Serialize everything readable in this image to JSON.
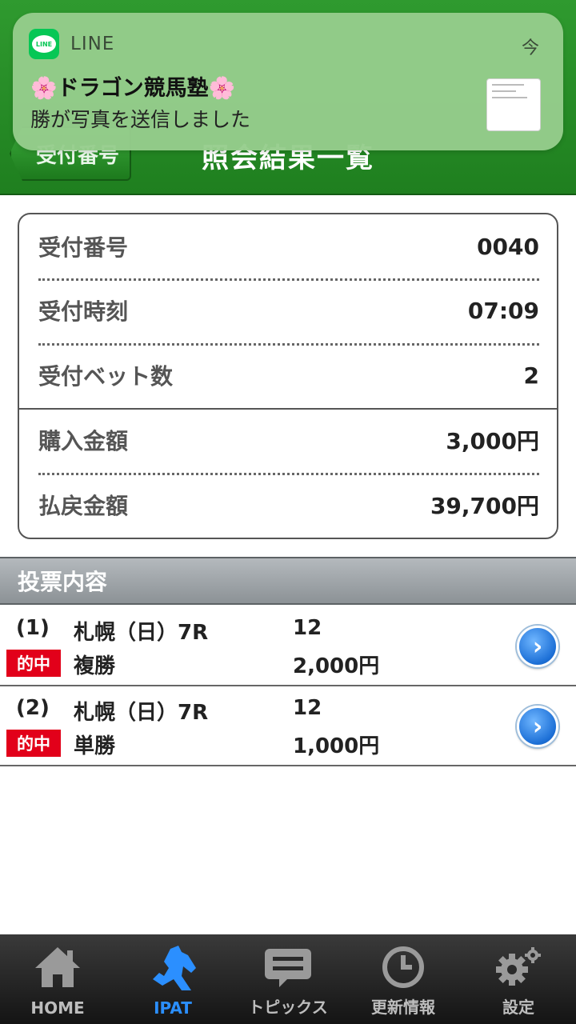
{
  "notification": {
    "app": "LINE",
    "time": "今",
    "logo_text": "LINE",
    "title": "🌸ドラゴン競馬塾🌸",
    "body": "勝が写真を送信しました"
  },
  "header": {
    "back_label": "受付番号",
    "title": "照会結果一覧"
  },
  "summary": {
    "rows": [
      {
        "label": "受付番号",
        "value": "0040"
      },
      {
        "label": "受付時刻",
        "value": "07:09"
      },
      {
        "label": "受付ベット数",
        "value": "2"
      },
      {
        "label": "購入金額",
        "value": "3,000円"
      },
      {
        "label": "払戻金額",
        "value": "39,700円"
      }
    ]
  },
  "section_title": "投票内容",
  "bets": [
    {
      "num": "(1)",
      "race": "札幌（日）7R",
      "horse": "12",
      "badge": "的中",
      "type": "複勝",
      "amount": "2,000円"
    },
    {
      "num": "(2)",
      "race": "札幌（日）7R",
      "horse": "12",
      "badge": "的中",
      "type": "単勝",
      "amount": "1,000円"
    }
  ],
  "tabs": [
    {
      "label": "HOME",
      "icon": "house-icon"
    },
    {
      "label": "IPAT",
      "icon": "horse-icon",
      "active": true
    },
    {
      "label": "トピックス",
      "icon": "speech-bubble-icon"
    },
    {
      "label": "更新情報",
      "icon": "clock-icon"
    },
    {
      "label": "設定",
      "icon": "gear-icon"
    }
  ],
  "colors": {
    "header_green": "#1f7f1f",
    "notification_bg": "#96cd8c",
    "badge_red": "#e2001a",
    "active_tab": "#2b8fff"
  }
}
